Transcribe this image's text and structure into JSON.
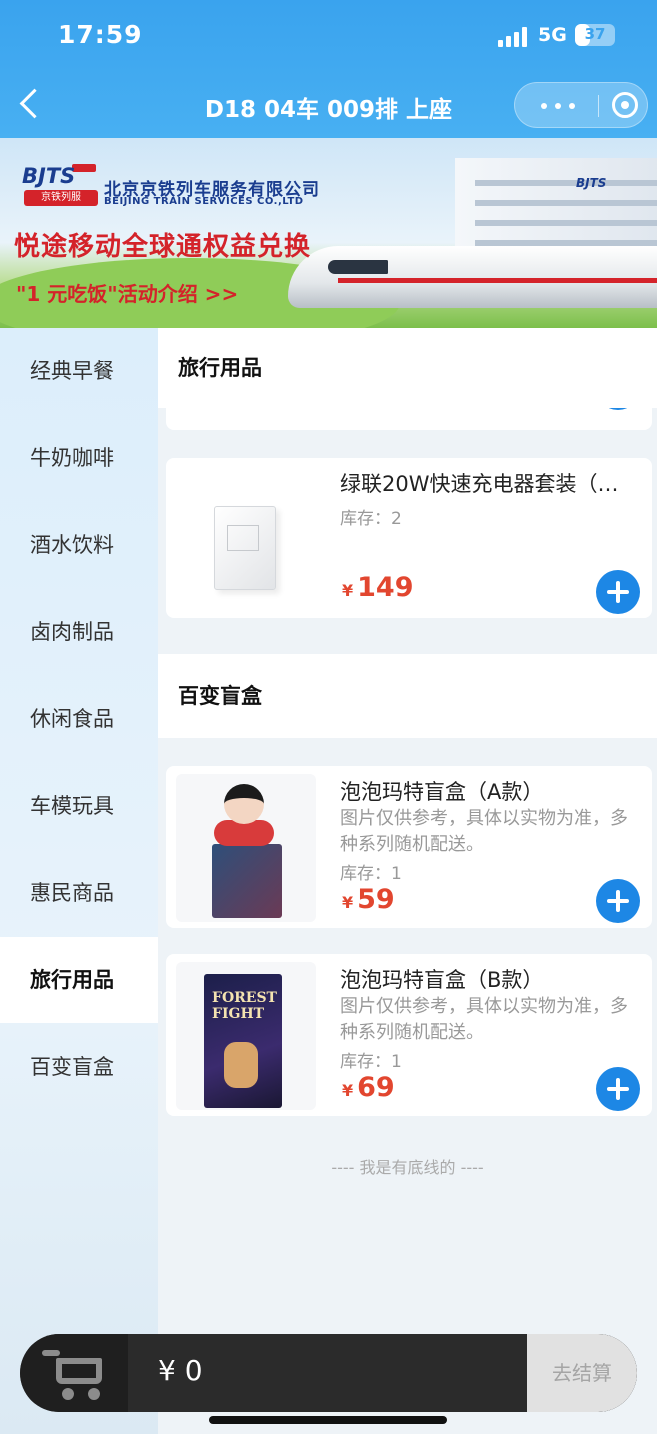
{
  "status_bar": {
    "time": "17:59",
    "network": "5G",
    "battery": "37",
    "battery_level": 0.37
  },
  "nav": {
    "title": "D18 04车 009排 上座"
  },
  "banner": {
    "logo_text": "BJTS",
    "logo_sub": "京铁列服",
    "company_cn": "北京京铁列车服务有限公司",
    "company_en": "BEIJING TRAIN SERVICES CO.,LTD",
    "promo_title": "悦途移动全球通权益兑换",
    "promo_link": "\"1 元吃饭\"活动介绍 >>",
    "building_logo": "BJTS"
  },
  "sidebar": {
    "items": [
      {
        "label": "经典早餐"
      },
      {
        "label": "牛奶咖啡"
      },
      {
        "label": "酒水饮料"
      },
      {
        "label": "卤肉制品"
      },
      {
        "label": "休闲食品"
      },
      {
        "label": "车模玩具"
      },
      {
        "label": "惠民商品"
      },
      {
        "label": "旅行用品"
      },
      {
        "label": "百变盲盒"
      }
    ],
    "active": "旅行用品"
  },
  "content": {
    "sections": [
      {
        "title": "旅行用品",
        "products": [
          {
            "name": "绿联20W快速充电器套装（…",
            "stock": "库存：2",
            "currency": "¥",
            "price": "149"
          }
        ]
      },
      {
        "title": "百变盲盒",
        "products": [
          {
            "name": "泡泡玛特盲盒（A款）",
            "desc": "图片仅供参考，具体以实物为准，多种系列随机配送。",
            "stock": "库存：1",
            "currency": "¥",
            "price": "59"
          },
          {
            "name": "泡泡玛特盲盒（B款）",
            "desc": "图片仅供参考，具体以实物为准，多种系列随机配送。",
            "stock": "库存：1",
            "currency": "¥",
            "price": "69",
            "thumb_label": "FOREST FIGHT"
          }
        ]
      }
    ],
    "footer_note": "---- 我是有底线的 ----"
  },
  "cart": {
    "total": "¥ 0",
    "checkout_label": "去结算"
  },
  "colors": {
    "primary": "#3aa3ee",
    "accent_blue": "#1d87e5",
    "price_red": "#e2462f"
  }
}
